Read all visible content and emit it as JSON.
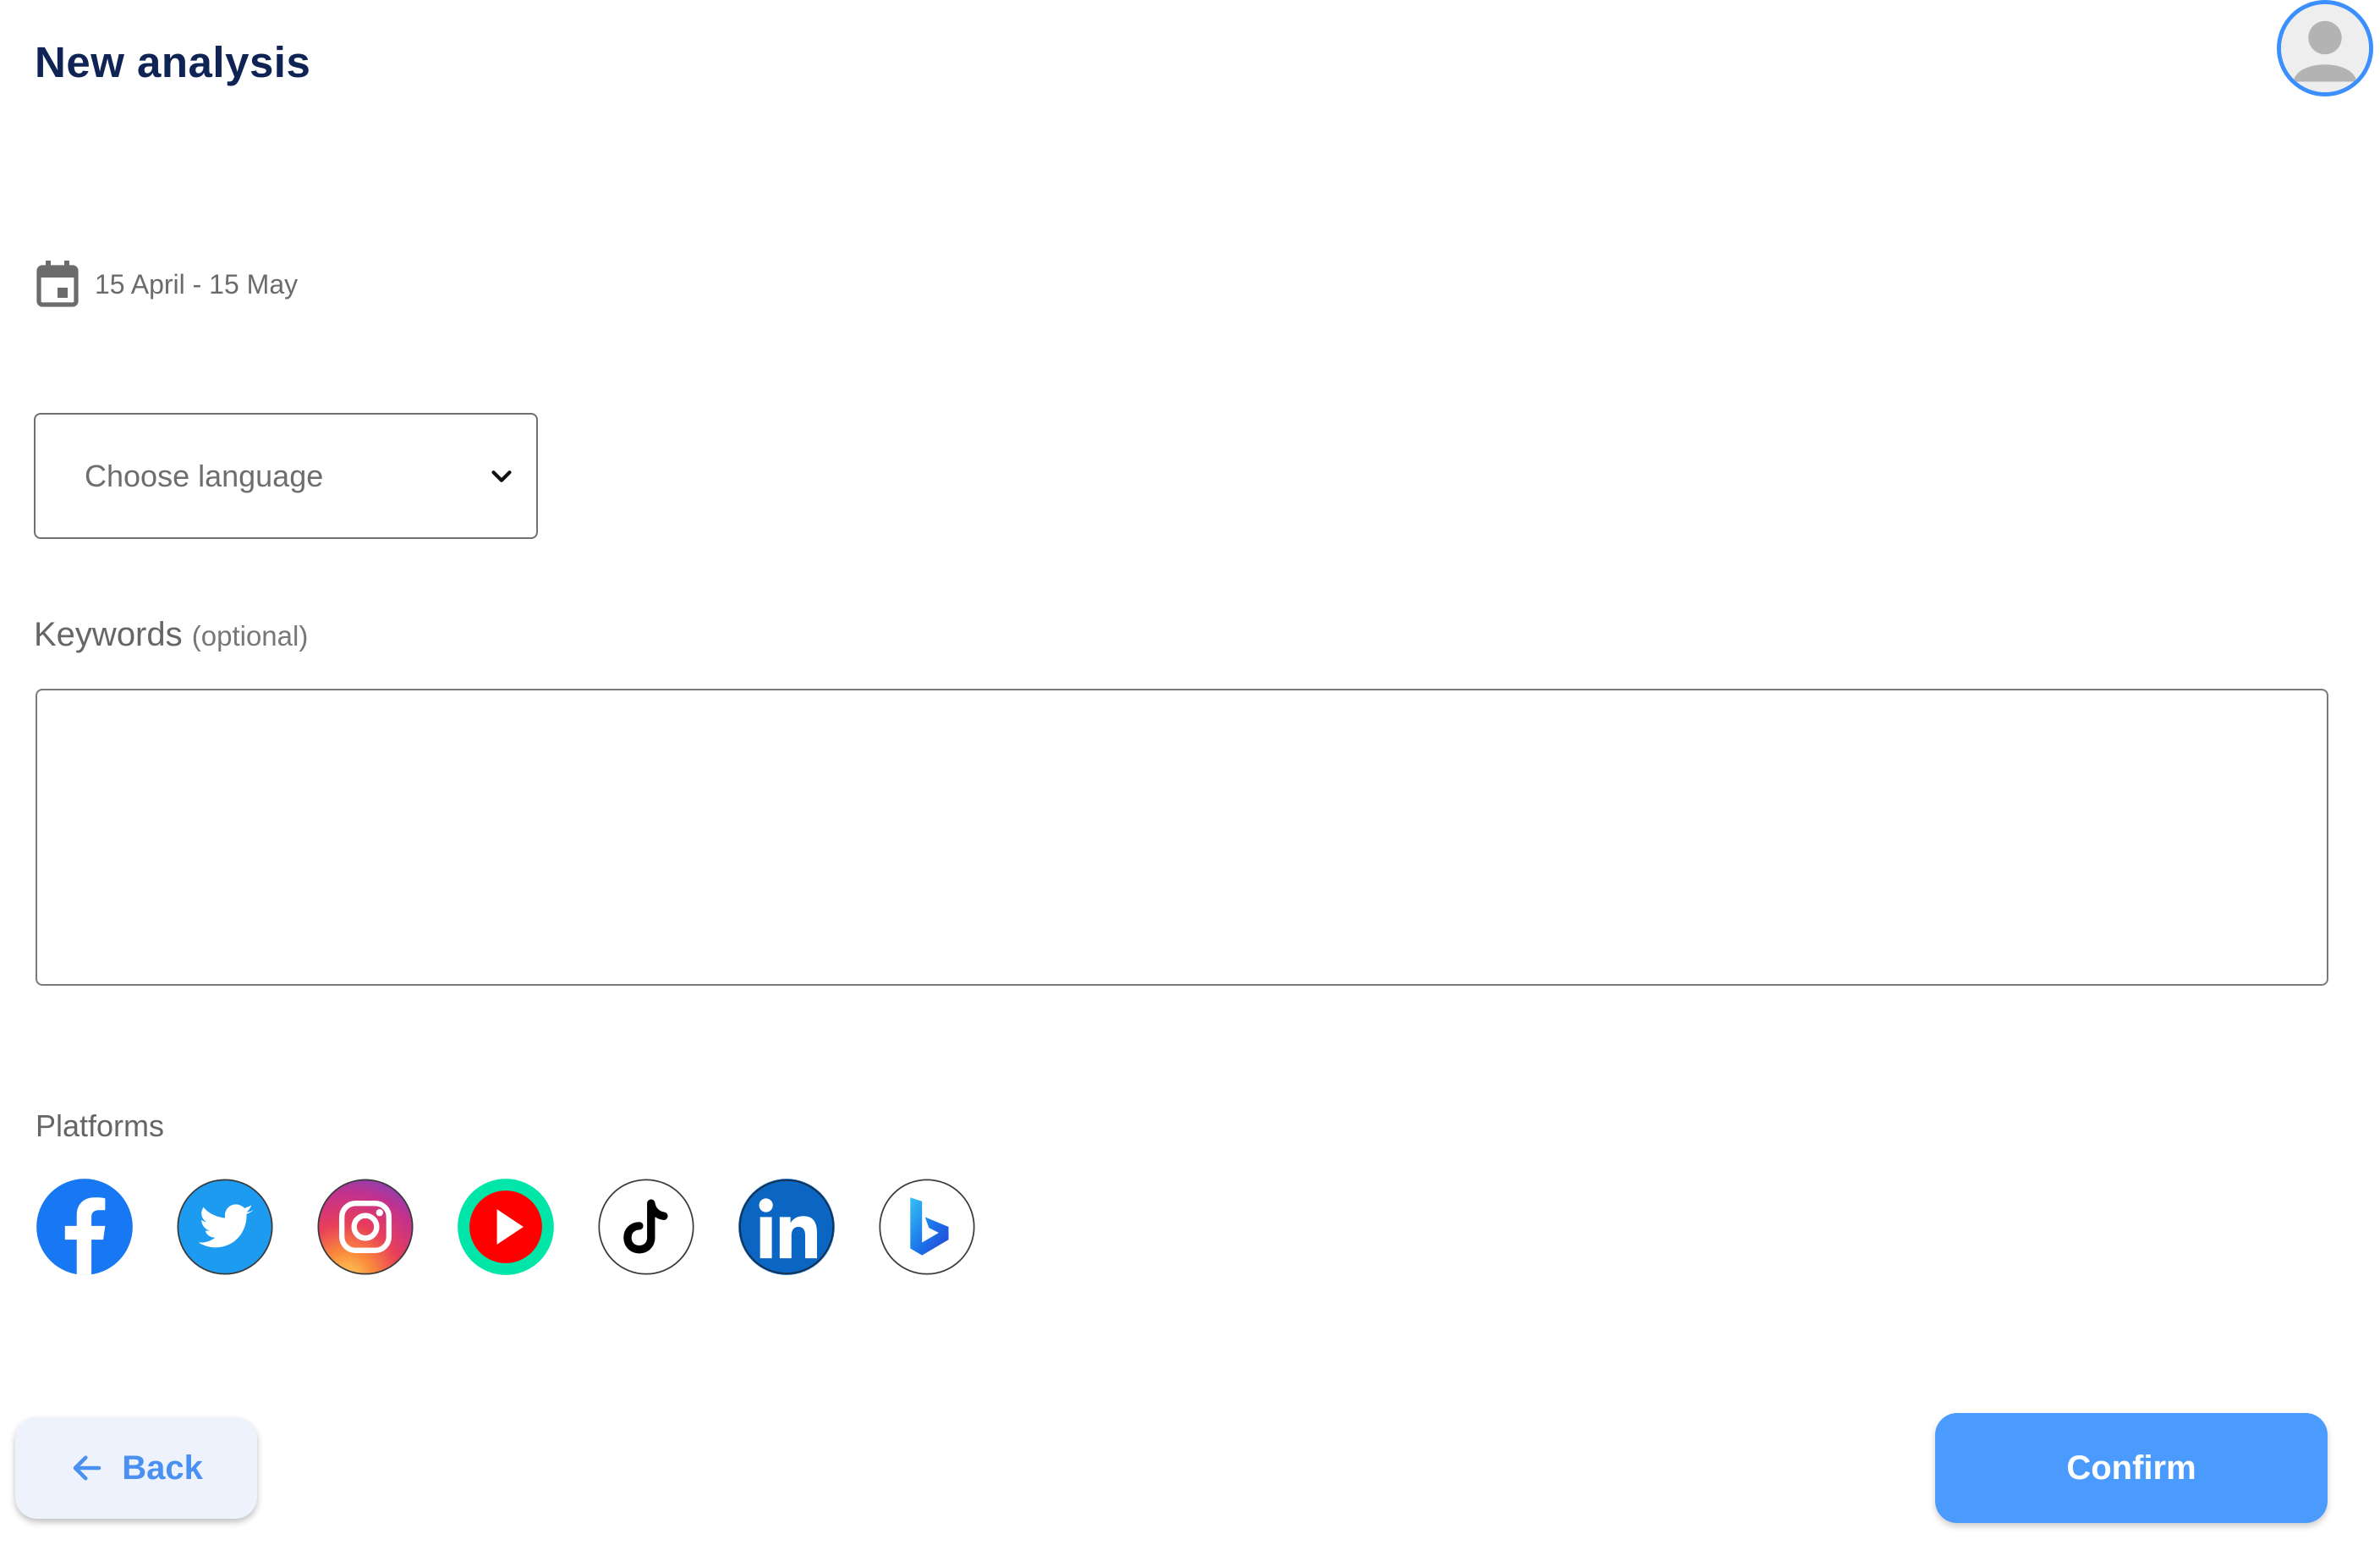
{
  "page": {
    "title": "New analysis"
  },
  "date_range": {
    "icon": "calendar-icon",
    "text": "15 April - 15 May"
  },
  "language": {
    "placeholder": "Choose language",
    "icon": "chevron-down-icon"
  },
  "keywords": {
    "label": "Keywords",
    "hint": "(optional)",
    "value": ""
  },
  "platforms": {
    "label": "Platforms",
    "items": [
      "facebook-icon",
      "twitter-icon",
      "instagram-icon",
      "youtube-icon",
      "tiktok-icon",
      "linkedin-icon",
      "bing-icon"
    ]
  },
  "actions": {
    "back_label": "Back",
    "confirm_label": "Confirm"
  },
  "colors": {
    "title": "#0f2454",
    "accent": "#4b9bff",
    "back_bg": "#eef2fc",
    "back_text": "#4a90f0"
  }
}
